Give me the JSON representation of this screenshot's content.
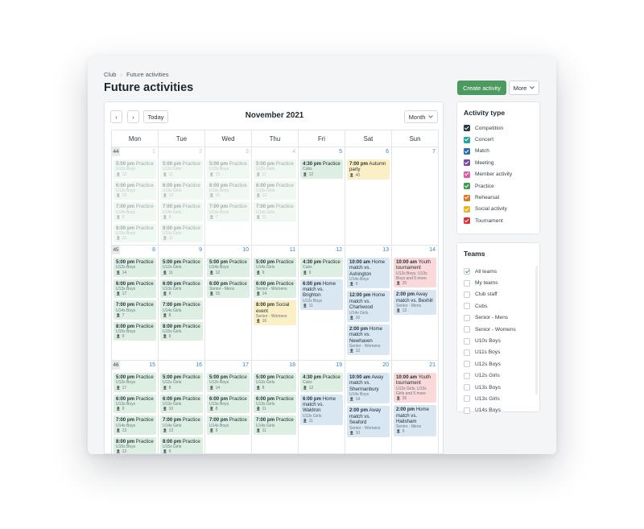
{
  "breadcrumb": {
    "root": "Club",
    "sep": "·",
    "current": "Future activities"
  },
  "page_title": "Future activities",
  "actions": {
    "create": "Create activity",
    "more": "More"
  },
  "calendar": {
    "prev": "‹",
    "next": "›",
    "today": "Today",
    "month_label": "November 2021",
    "view": "Month",
    "weekdays": [
      "Mon",
      "Tue",
      "Wed",
      "Thu",
      "Fri",
      "Sat",
      "Sun"
    ],
    "weeks": [
      {
        "week": "44",
        "days": [
          {
            "num": "1",
            "past": true,
            "events": [
              {
                "time": "5:00 pm",
                "title": "Practice",
                "team": "U12s Boys",
                "count": "12",
                "type": "practice"
              },
              {
                "time": "6:00 pm",
                "title": "Practice",
                "team": "U13s Boys",
                "count": "15",
                "type": "practice"
              },
              {
                "time": "7:00 pm",
                "title": "Practice",
                "team": "U14s Boys",
                "count": "9",
                "type": "practice"
              },
              {
                "time": "8:00 pm",
                "title": "Practice",
                "team": "U15s Boys",
                "count": "11",
                "type": "practice"
              }
            ]
          },
          {
            "num": "2",
            "past": true,
            "events": [
              {
                "time": "5:00 pm",
                "title": "Practice",
                "team": "U12s Girls",
                "count": "11",
                "type": "practice"
              },
              {
                "time": "6:00 pm",
                "title": "Practice",
                "team": "U13s Girls",
                "count": "13",
                "type": "practice"
              },
              {
                "time": "7:00 pm",
                "title": "Practice",
                "team": "U14s Girls",
                "count": "8",
                "type": "practice"
              },
              {
                "time": "8:00 pm",
                "title": "Practice",
                "team": "U15s Girls",
                "count": "11",
                "type": "practice"
              }
            ]
          },
          {
            "num": "3",
            "past": true,
            "events": [
              {
                "time": "5:00 pm",
                "title": "Practice",
                "team": "U12s Boys",
                "count": "13",
                "type": "practice"
              },
              {
                "time": "6:00 pm",
                "title": "Practice",
                "team": "U13s Boys",
                "count": "16",
                "type": "practice"
              },
              {
                "time": "7:00 pm",
                "title": "Practice",
                "team": "U14s Boys",
                "count": "7",
                "type": "practice"
              }
            ]
          },
          {
            "num": "4",
            "past": true,
            "events": [
              {
                "time": "5:00 pm",
                "title": "Practice",
                "team": "U12s Girls",
                "count": "11",
                "type": "practice"
              },
              {
                "time": "6:00 pm",
                "title": "Practice",
                "team": "U13s Girls",
                "count": "13",
                "type": "practice"
              },
              {
                "time": "7:00 pm",
                "title": "Practice",
                "team": "U14s Girls",
                "count": "11",
                "type": "practice"
              }
            ]
          },
          {
            "num": "5",
            "past": false,
            "events": [
              {
                "time": "4:30 pm",
                "title": "Practice",
                "team": "Cubs",
                "count": "12",
                "type": "practice"
              }
            ]
          },
          {
            "num": "6",
            "past": false,
            "events": [
              {
                "time": "7:00 pm",
                "title": "Autumn party",
                "team": "",
                "count": "40",
                "type": "social"
              }
            ]
          },
          {
            "num": "7",
            "past": false,
            "events": []
          }
        ]
      },
      {
        "week": "45",
        "days": [
          {
            "num": "8",
            "past": false,
            "events": [
              {
                "time": "5:00 pm",
                "title": "Practice",
                "team": "U12s Boys",
                "count": "14",
                "type": "practice"
              },
              {
                "time": "6:00 pm",
                "title": "Practice",
                "team": "U13s Boys",
                "count": "17",
                "type": "practice"
              },
              {
                "time": "7:00 pm",
                "title": "Practice",
                "team": "U14s Boys",
                "count": "7",
                "type": "practice"
              },
              {
                "time": "8:00 pm",
                "title": "Practice",
                "team": "U15s Boys",
                "count": "9",
                "type": "practice"
              }
            ]
          },
          {
            "num": "9",
            "past": false,
            "events": [
              {
                "time": "5:00 pm",
                "title": "Practice",
                "team": "U12s Girls",
                "count": "11",
                "type": "practice"
              },
              {
                "time": "6:00 pm",
                "title": "Practice",
                "team": "U13s Girls",
                "count": "9",
                "type": "practice"
              },
              {
                "time": "7:00 pm",
                "title": "Practice",
                "team": "U14s Girls",
                "count": "8",
                "type": "practice"
              },
              {
                "time": "8:00 pm",
                "title": "Practice",
                "team": "U15s Girls",
                "count": "9",
                "type": "practice"
              }
            ]
          },
          {
            "num": "10",
            "past": false,
            "events": [
              {
                "time": "5:00 pm",
                "title": "Practice",
                "team": "U14s Boys",
                "count": "12",
                "type": "practice"
              },
              {
                "time": "6:00 pm",
                "title": "Practice",
                "team": "Senior - Mens",
                "count": "15",
                "type": "practice"
              }
            ]
          },
          {
            "num": "11",
            "past": false,
            "events": [
              {
                "time": "5:00 pm",
                "title": "Practice",
                "team": "U14s Girls",
                "count": "9",
                "type": "practice"
              },
              {
                "time": "6:00 pm",
                "title": "Practice",
                "team": "Senior - Womens",
                "count": "14",
                "type": "practice"
              },
              {
                "time": "8:00 pm",
                "title": "Social event",
                "team": "Senior - Womens",
                "count": "16",
                "type": "social"
              }
            ]
          },
          {
            "num": "12",
            "past": false,
            "events": [
              {
                "time": "4:30 pm",
                "title": "Practice",
                "team": "Cubs",
                "count": "9",
                "type": "practice"
              },
              {
                "time": "6:00 pm",
                "title": "Home match vs. Brighton",
                "team": "U12s Boys",
                "count": "11",
                "type": "match"
              }
            ]
          },
          {
            "num": "13",
            "past": false,
            "events": [
              {
                "time": "10:00 am",
                "title": "Home match vs. Ashington",
                "team": "U14s Boys",
                "count": "9",
                "type": "match"
              },
              {
                "time": "12:00 pm",
                "title": "Home match vs. Charlwood",
                "team": "U14s Girls",
                "count": "10",
                "type": "match"
              },
              {
                "time": "2:00 pm",
                "title": "Home match vs. Newhaven",
                "team": "Senior - Womens",
                "count": "12",
                "type": "match"
              }
            ]
          },
          {
            "num": "14",
            "past": false,
            "events": [
              {
                "time": "10:00 am",
                "title": "Youth tournament",
                "team": "U12s Boys, U13s Boys and 5 more",
                "count": "25",
                "type": "tourn"
              },
              {
                "time": "2:00 pm",
                "title": "Away match vs. Bexhill",
                "team": "Senior - Mens",
                "count": "13",
                "type": "match"
              }
            ]
          }
        ]
      },
      {
        "week": "46",
        "days": [
          {
            "num": "15",
            "past": false,
            "events": [
              {
                "time": "5:00 pm",
                "title": "Practice",
                "team": "U12s Boys",
                "count": "17",
                "type": "practice"
              },
              {
                "time": "6:00 pm",
                "title": "Practice",
                "team": "U13s Boys",
                "count": "9",
                "type": "practice"
              },
              {
                "time": "7:00 pm",
                "title": "Practice",
                "team": "U14s Boys",
                "count": "13",
                "type": "practice"
              },
              {
                "time": "8:00 pm",
                "title": "Practice",
                "team": "U15s Boys",
                "count": "12",
                "type": "practice"
              }
            ]
          },
          {
            "num": "16",
            "past": false,
            "events": [
              {
                "time": "5:00 pm",
                "title": "Practice",
                "team": "U12s Girls",
                "count": "8",
                "type": "practice"
              },
              {
                "time": "6:00 pm",
                "title": "Practice",
                "team": "U13s Girls",
                "count": "10",
                "type": "practice"
              },
              {
                "time": "7:00 pm",
                "title": "Practice",
                "team": "U14s Girls",
                "count": "13",
                "type": "practice"
              },
              {
                "time": "8:00 pm",
                "title": "Practice",
                "team": "U15s Girls",
                "count": "9",
                "type": "practice"
              }
            ]
          },
          {
            "num": "17",
            "past": false,
            "events": [
              {
                "time": "5:00 pm",
                "title": "Practice",
                "team": "U12s Boys",
                "count": "14",
                "type": "practice"
              },
              {
                "time": "6:00 pm",
                "title": "Practice",
                "team": "U13s Boys",
                "count": "8",
                "type": "practice"
              },
              {
                "time": "7:00 pm",
                "title": "Practice",
                "team": "U14s Boys",
                "count": "9",
                "type": "practice"
              }
            ]
          },
          {
            "num": "18",
            "past": false,
            "events": [
              {
                "time": "5:00 pm",
                "title": "Practice",
                "team": "U12s Girls",
                "count": "8",
                "type": "practice"
              },
              {
                "time": "6:00 pm",
                "title": "Practice",
                "team": "U13s Girls",
                "count": "11",
                "type": "practice"
              },
              {
                "time": "7:00 pm",
                "title": "Practice",
                "team": "U14s Girls",
                "count": "11",
                "type": "practice"
              }
            ]
          },
          {
            "num": "19",
            "past": false,
            "events": [
              {
                "time": "4:30 pm",
                "title": "Practice",
                "team": "Cubs",
                "count": "12",
                "type": "practice"
              },
              {
                "time": "6:00 pm",
                "title": "Home match vs. Waldron",
                "team": "U13s Girls",
                "count": "11",
                "type": "match"
              }
            ]
          },
          {
            "num": "20",
            "past": false,
            "events": [
              {
                "time": "10:00 am",
                "title": "Away match vs. Shermanbury",
                "team": "U14s Boys",
                "count": "14",
                "type": "match"
              },
              {
                "time": "2:00 pm",
                "title": "Away match vs. Seaford",
                "team": "Senior - Womens",
                "count": "10",
                "type": "match"
              }
            ]
          },
          {
            "num": "21",
            "past": false,
            "events": [
              {
                "time": "10:00 am",
                "title": "Youth tournament",
                "team": "U12s Girls, U13s Girls and 5 more",
                "count": "26",
                "type": "tourn"
              },
              {
                "time": "2:00 pm",
                "title": "Home match vs. Hailsham",
                "team": "Senior - Mens",
                "count": "9",
                "type": "match"
              }
            ]
          }
        ]
      }
    ]
  },
  "activity_types": {
    "title": "Activity type",
    "items": [
      {
        "label": "Competition",
        "color": "#2d3a44"
      },
      {
        "label": "Concert",
        "color": "#2aa39a"
      },
      {
        "label": "Match",
        "color": "#2b6fa6"
      },
      {
        "label": "Meeting",
        "color": "#7a4a9e"
      },
      {
        "label": "Member activity",
        "color": "#e05aa8"
      },
      {
        "label": "Practice",
        "color": "#3f9a52"
      },
      {
        "label": "Rehearsal",
        "color": "#d97a2a"
      },
      {
        "label": "Social activity",
        "color": "#e6b62a"
      },
      {
        "label": "Tournament",
        "color": "#d33636"
      }
    ]
  },
  "teams": {
    "title": "Teams",
    "items": [
      {
        "label": "All teams",
        "checked": true
      },
      {
        "label": "My teams",
        "checked": false
      },
      {
        "label": "Club staff",
        "checked": false
      },
      {
        "label": "Cubs",
        "checked": false
      },
      {
        "label": "Senior - Mens",
        "checked": false
      },
      {
        "label": "Senior - Womens",
        "checked": false
      },
      {
        "label": "U10s Boys",
        "checked": false
      },
      {
        "label": "U11s Boys",
        "checked": false
      },
      {
        "label": "U12s Boys",
        "checked": false
      },
      {
        "label": "U12s Girls",
        "checked": false
      },
      {
        "label": "U13s Boys",
        "checked": false
      },
      {
        "label": "U13s Girls",
        "checked": false
      },
      {
        "label": "U14s Boys",
        "checked": false
      }
    ]
  }
}
